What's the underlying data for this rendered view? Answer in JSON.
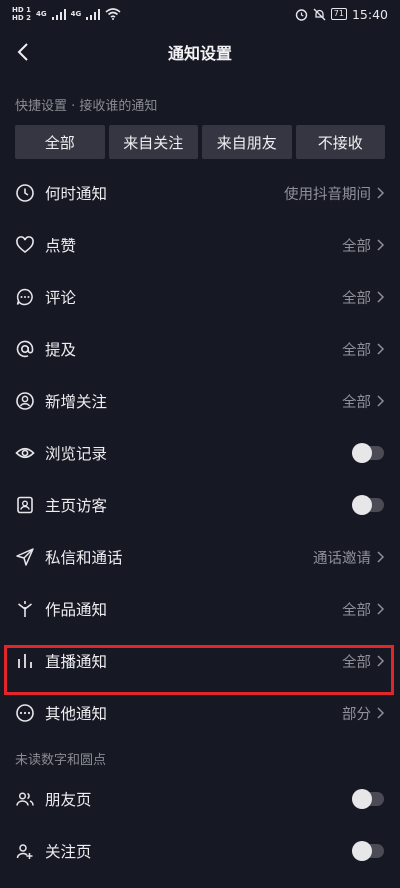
{
  "status": {
    "left_mini_1": "HD 1",
    "left_mini_2": "HD 2",
    "net1": "4G",
    "net2": "4G",
    "battery": "71",
    "time": "15:40"
  },
  "header": {
    "title": "通知设置"
  },
  "quick": {
    "title": "快捷设置 · 接收谁的通知",
    "buttons": [
      "全部",
      "来自关注",
      "来自朋友",
      "不接收"
    ]
  },
  "rows": [
    {
      "label": "何时通知",
      "value": "使用抖音期间",
      "icon": "clock-icon"
    },
    {
      "label": "点赞",
      "value": "全部",
      "icon": "heart-icon"
    },
    {
      "label": "评论",
      "value": "全部",
      "icon": "comment-icon"
    },
    {
      "label": "提及",
      "value": "全部",
      "icon": "at-icon"
    },
    {
      "label": "新增关注",
      "value": "全部",
      "icon": "user-circle-icon"
    },
    {
      "label": "浏览记录",
      "value": "",
      "icon": "eye-icon",
      "toggle": false
    },
    {
      "label": "主页访客",
      "value": "",
      "icon": "profile-card-icon",
      "toggle": false
    },
    {
      "label": "私信和通话",
      "value": "通话邀请",
      "icon": "send-icon"
    },
    {
      "label": "作品通知",
      "value": "全部",
      "icon": "sparkle-icon"
    },
    {
      "label": "直播通知",
      "value": "全部",
      "icon": "bars-icon"
    },
    {
      "label": "其他通知",
      "value": "部分",
      "icon": "more-dots-icon"
    }
  ],
  "unread": {
    "title": "未读数字和圆点",
    "rows": [
      {
        "label": "朋友页",
        "icon": "friends-icon",
        "toggle": false
      },
      {
        "label": "关注页",
        "icon": "follow-icon",
        "toggle": false
      }
    ]
  },
  "colors": {
    "background": "#161823",
    "button": "#353641",
    "highlight": "#e0262b"
  }
}
